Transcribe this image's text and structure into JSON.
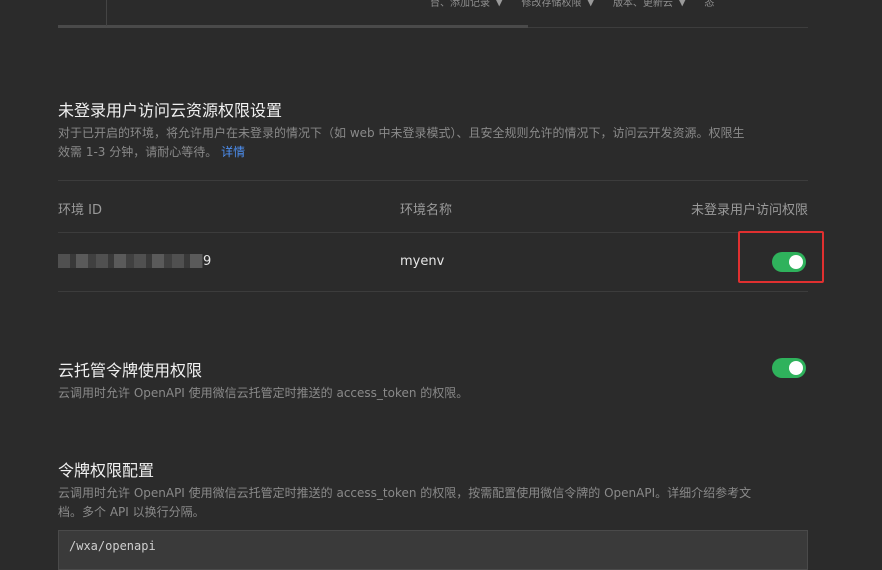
{
  "top_menu": [
    {
      "label": "台、添加记录"
    },
    {
      "label": "修改存储权限"
    },
    {
      "label": "版本、更新云"
    },
    {
      "label": "态"
    }
  ],
  "unauth_section": {
    "title": "未登录用户访问云资源权限设置",
    "desc_line1": "对于已开启的环境，将允许用户在未登录的情况下（如 web 中未登录模式）、且安全规则允许的情况下，访问云开发资源。权限生",
    "desc_line2": "效需 1-3 分钟，请耐心等待。",
    "detail_link": "详情"
  },
  "env_table": {
    "headers": {
      "env_id": "环境 ID",
      "env_name": "环境名称",
      "permission": "未登录用户访问权限"
    },
    "rows": [
      {
        "env_id_suffix": "9",
        "env_name": "myenv",
        "permission_enabled": true
      }
    ]
  },
  "cloud_token": {
    "title": "云托管令牌使用权限",
    "desc": "云调用时允许 OpenAPI 使用微信云托管定时推送的 access_token 的权限。",
    "enabled": true
  },
  "token_config": {
    "title": "令牌权限配置",
    "desc_line1": "云调用时允许 OpenAPI 使用微信云托管定时推送的 access_token 的权限，按需配置使用微信令牌的 OpenAPI。详细介绍参考文",
    "desc_line2": "档。多个 API 以换行分隔。",
    "api_value": "/wxa/openapi"
  },
  "colors": {
    "toggle_on": "#2fb25c",
    "link": "#4d8ff0",
    "highlight": "#e03030"
  }
}
